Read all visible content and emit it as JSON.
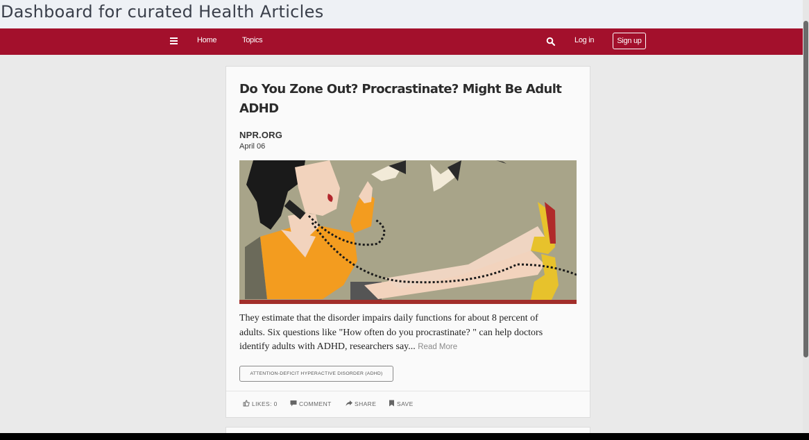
{
  "window": {
    "title": "Dashboard for curated Health Articles"
  },
  "navbar": {
    "menu_icon": "hamburger-icon",
    "home_label": "Home",
    "topics_label": "Topics",
    "search_icon": "search-icon",
    "login_label": "Log in",
    "signup_label": "Sign up",
    "color": "#a3102c"
  },
  "article": {
    "title": "Do You Zone Out? Procrastinate? Might Be Adult ADHD",
    "source": "NPR.ORG",
    "date": "April 06",
    "excerpt": "They estimate that the disorder impairs daily functions for about 8 percent of adults. Six questions like \"How often do you procrastinate? \" can help doctors identify adults with ADHD, researchers say...",
    "read_more": "Read More",
    "tag": "ATTENTION-DEFICIT HYPERACTIVE DISORDER (ADHD)",
    "image_icon": "woman-on-phone-illustration",
    "actions": {
      "likes": "LIKES: 0",
      "comment": "COMMENT",
      "share": "SHARE",
      "save": "SAVE"
    }
  }
}
